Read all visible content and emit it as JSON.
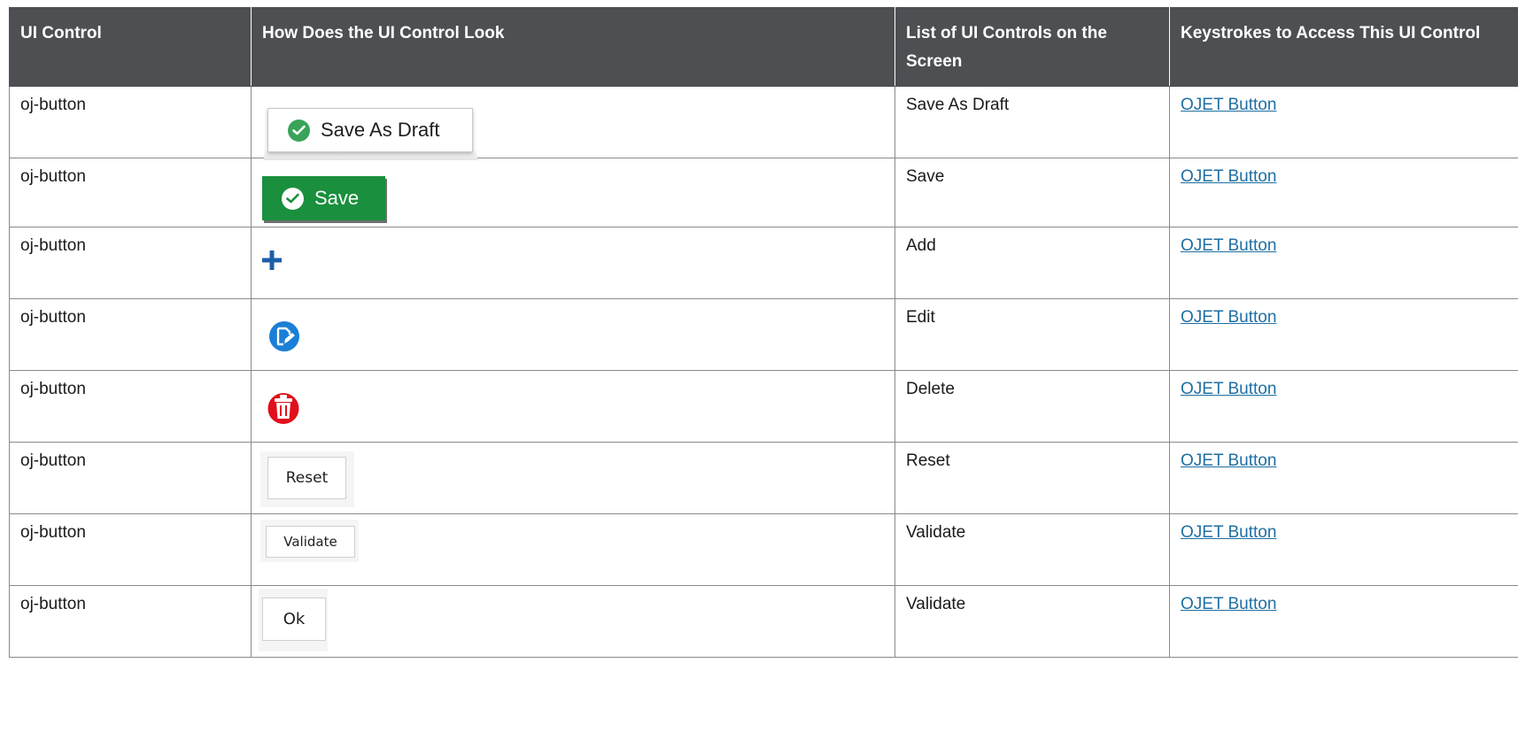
{
  "table": {
    "headers": [
      "UI Control",
      "How Does the UI Control Look",
      "List of UI Controls on the Screen",
      "Keystrokes to Access This UI Control"
    ],
    "rows": [
      {
        "control": "oj-button",
        "look": "Save As Draft",
        "name": "Save As Draft",
        "keystrokes": "OJET Button"
      },
      {
        "control": "oj-button",
        "look": "Save",
        "name": "Save",
        "keystrokes": "OJET Button"
      },
      {
        "control": "oj-button",
        "look": "",
        "name": "Add",
        "keystrokes": "OJET Button"
      },
      {
        "control": "oj-button",
        "look": "",
        "name": "Edit",
        "keystrokes": "OJET Button"
      },
      {
        "control": "oj-button",
        "look": "",
        "name": "Delete",
        "keystrokes": "OJET Button"
      },
      {
        "control": "oj-button",
        "look": "Reset",
        "name": "Reset",
        "keystrokes": "OJET Button"
      },
      {
        "control": "oj-button",
        "look": "Validate",
        "name": "Validate",
        "keystrokes": "OJET Button"
      },
      {
        "control": "oj-button",
        "look": "Ok",
        "name": "Validate",
        "keystrokes": "OJET Button"
      }
    ]
  },
  "icons": {
    "add": "plus-icon",
    "edit": "edit-icon",
    "delete": "trash-icon",
    "check": "check-circle-icon"
  },
  "colors": {
    "header_bg": "#4d4f53",
    "link": "#1f6fa3",
    "save_green": "#1a8f3d",
    "add_blue": "#1b5fa8",
    "edit_blue": "#1a7fd6",
    "delete_red": "#e0101c"
  }
}
